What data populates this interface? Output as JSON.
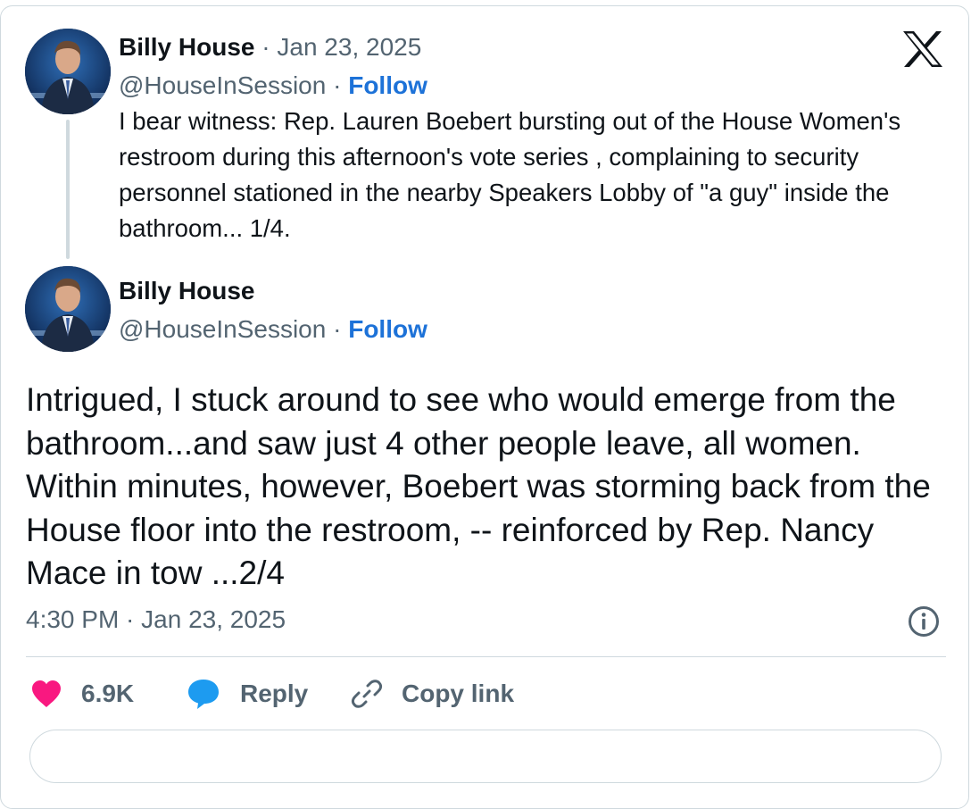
{
  "quoted_tweet": {
    "author_name": "Billy House",
    "separator": " · ",
    "date": "Jan 23, 2025",
    "handle": "@HouseInSession",
    "follow_label": "Follow",
    "text": "I bear witness: Rep. Lauren Boebert bursting out of the House Women's restroom during this afternoon's vote series , complaining to security personnel stationed in the nearby Speakers Lobby of \"a guy\" inside the bathroom... 1/4."
  },
  "main_tweet": {
    "author_name": "Billy House",
    "separator": " · ",
    "handle": "@HouseInSession",
    "follow_label": "Follow",
    "text": "Intrigued, I stuck around to see who would emerge from the bathroom...and saw just 4 other people leave, all women. Within minutes, however, Boebert was storming back from the House floor into the restroom, -- reinforced by Rep. Nancy Mace in tow ...2/4",
    "timestamp": "4:30 PM · Jan 23, 2025"
  },
  "actions": {
    "like_count": "6.9K",
    "reply_label": "Reply",
    "copy_link_label": "Copy link"
  },
  "icons": {
    "brand": "x-logo-icon",
    "info": "info-icon",
    "like": "heart-icon",
    "reply": "speech-bubble-icon",
    "copy_link": "link-icon"
  },
  "colors": {
    "follow": "#1d72d8",
    "heart": "#f91880",
    "reply_bubble": "#1d9bf0",
    "muted_text": "#536471",
    "border": "#cfd9de"
  }
}
